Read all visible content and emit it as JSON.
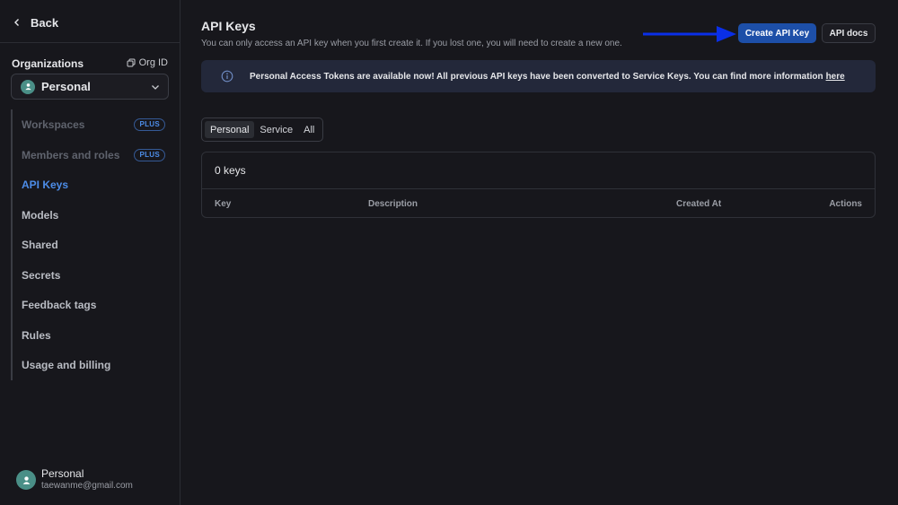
{
  "sidebar": {
    "back_label": "Back",
    "org_label": "Organizations",
    "org_id_label": "Org ID",
    "org_select_value": "Personal",
    "items": [
      {
        "label": "Workspaces",
        "badge": "PLUS"
      },
      {
        "label": "Members and roles",
        "badge": "PLUS"
      },
      {
        "label": "API Keys"
      },
      {
        "label": "Models"
      },
      {
        "label": "Shared"
      },
      {
        "label": "Secrets"
      },
      {
        "label": "Feedback tags"
      },
      {
        "label": "Rules"
      },
      {
        "label": "Usage and billing"
      }
    ],
    "user": {
      "name": "Personal",
      "email": "taewanme@gmail.com"
    }
  },
  "main": {
    "title": "API Keys",
    "subtitle": "You can only access an API key when you first create it. If you lost one, you will need to create a new one.",
    "create_button": "Create API Key",
    "docs_button": "API docs",
    "banner": {
      "text": "Personal Access Tokens are available now! All previous API keys have been converted to Service Keys. You can find more information",
      "link": "here"
    },
    "filter_tabs": [
      "Personal",
      "Service",
      "All"
    ],
    "selected_tab": "Personal",
    "keys_count": "0 keys",
    "columns": [
      "Key",
      "Description",
      "Created At",
      "Actions"
    ]
  },
  "colors": {
    "background": "#17171c",
    "accent": "#4d8de8",
    "primary_button": "#1d4fa8",
    "annotation_arrow": "#0a2fe8"
  }
}
